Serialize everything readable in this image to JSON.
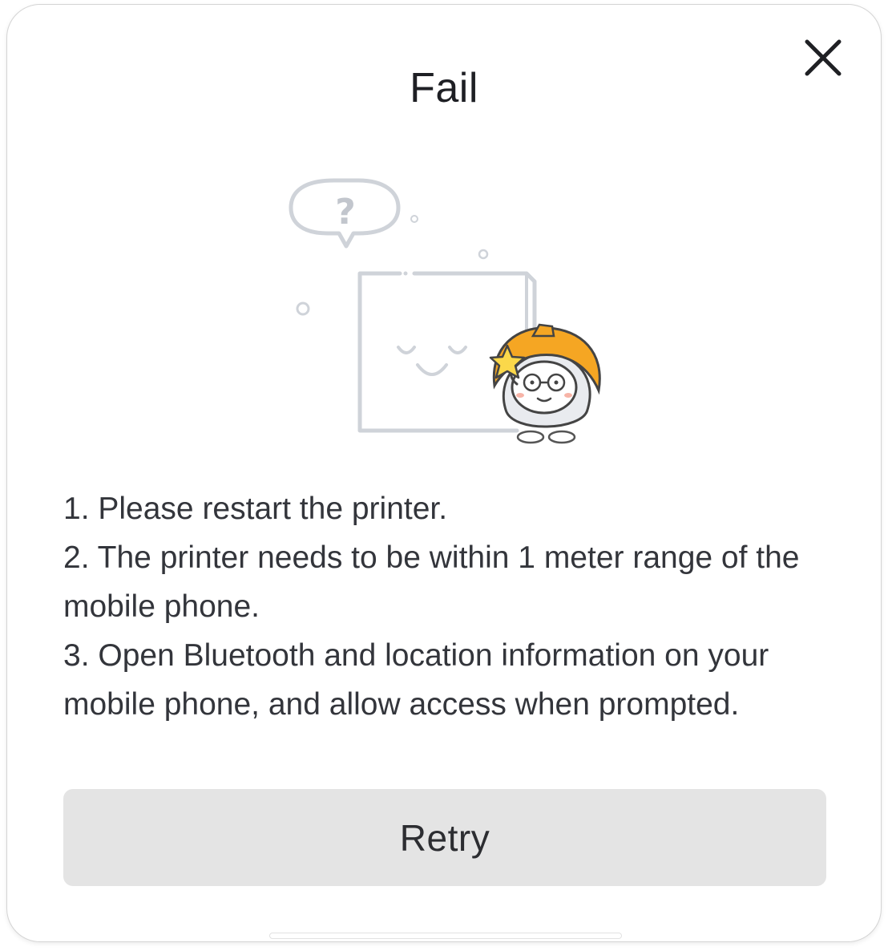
{
  "dialog": {
    "title": "Fail",
    "close_icon": "close-icon",
    "illustration": "printer-mascot-illustration",
    "question_mark": "?",
    "instructions": [
      "1. Please restart the printer.",
      "2. The printer needs to be within 1 meter range of the mobile phone.",
      "3. Open Bluetooth and location information on your mobile phone, and allow access when prompted."
    ],
    "retry_label": "Retry"
  },
  "colors": {
    "title_text": "#1e1f24",
    "body_text": "#33353b",
    "button_bg": "#e4e4e4",
    "illustration_line": "#cfd3d9",
    "mascot_orange": "#f5a623"
  }
}
